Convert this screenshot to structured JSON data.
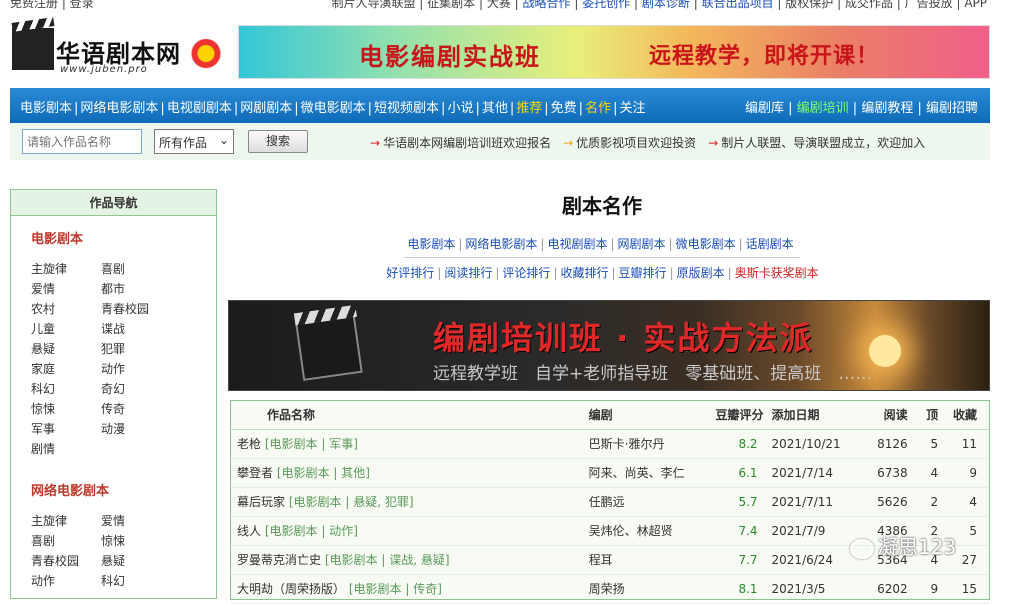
{
  "topbar": {
    "left": "免费注册 | 登录",
    "right_items": [
      "制片人导演联盟",
      "征集剧本",
      "大赛",
      "战略合作",
      "委托创作",
      "剧本诊断",
      "联合出品项目",
      "版权保护",
      "成交作品",
      "广告投放",
      "APP"
    ]
  },
  "logo": {
    "title": "华语剧本网",
    "url": "www.juben.pro"
  },
  "banner_top": {
    "text1": "电影编剧实战班",
    "text2": "远程教学，即将开课！"
  },
  "nav": {
    "items": [
      "电影剧本",
      "网络电影剧本",
      "电视剧剧本",
      "网剧剧本",
      "微电影剧本",
      "短视频剧本",
      "小说",
      "其他"
    ],
    "highlight_items": [
      "推荐",
      "免费",
      "名作",
      "关注"
    ],
    "right_items": [
      "编剧库",
      "编剧培训",
      "编剧教程",
      "编剧招聘"
    ]
  },
  "search": {
    "placeholder": "请输入作品名称",
    "select_value": "所有作品",
    "button": "搜索",
    "notices": [
      "华语剧本网编剧培训班欢迎报名",
      "优质影视项目欢迎投资",
      "制片人联盟、导演联盟成立，欢迎加入"
    ]
  },
  "sidebar": {
    "title": "作品导航",
    "sections": [
      {
        "title": "电影剧本",
        "items": [
          "主旋律",
          "喜剧",
          "爱情",
          "都市",
          "农村",
          "青春校园",
          "儿童",
          "谍战",
          "悬疑",
          "犯罪",
          "家庭",
          "动作",
          "科幻",
          "奇幻",
          "惊悚",
          "传奇",
          "军事",
          "动漫",
          "剧情"
        ]
      },
      {
        "title": "网络电影剧本",
        "items": [
          "主旋律",
          "爱情",
          "喜剧",
          "惊悚",
          "青春校园",
          "悬疑",
          "动作",
          "科幻"
        ]
      }
    ]
  },
  "main": {
    "title": "剧本名作",
    "links1": [
      "电影剧本",
      "网络电影剧本",
      "电视剧剧本",
      "网剧剧本",
      "微电影剧本",
      "话剧剧本"
    ],
    "links2": [
      "好评排行",
      "阅读排行",
      "评论排行",
      "收藏排行",
      "豆瓣排行",
      "原版剧本",
      "奥斯卡获奖剧本"
    ]
  },
  "promo": {
    "title": "编剧培训班 · 实战方法派",
    "subtitle": "远程教学班　自学+老师指导班　零基础班、提高班　……"
  },
  "table": {
    "headers": [
      "作品名称",
      "编剧",
      "豆瓣评分",
      "添加日期",
      "阅读",
      "顶",
      "收藏"
    ],
    "rows": [
      {
        "name": "老枪",
        "tag": "[电影剧本 | 军事]",
        "writer": "巴斯卡·雅尔丹",
        "score": "8.2",
        "date": "2021/10/21",
        "reads": "8126",
        "up": "5",
        "fav": "11"
      },
      {
        "name": "攀登者",
        "tag": "[电影剧本 | 其他]",
        "writer": "阿来、尚英、李仁",
        "score": "6.1",
        "date": "2021/7/14",
        "reads": "6738",
        "up": "4",
        "fav": "9"
      },
      {
        "name": "幕后玩家",
        "tag": "[电影剧本 | 悬疑, 犯罪]",
        "writer": "任鹏远",
        "score": "5.7",
        "date": "2021/7/11",
        "reads": "5626",
        "up": "2",
        "fav": "4"
      },
      {
        "name": "线人",
        "tag": "[电影剧本 | 动作]",
        "writer": "吴炜伦、林超贤",
        "score": "7.4",
        "date": "2021/7/9",
        "reads": "4386",
        "up": "2",
        "fav": "5"
      },
      {
        "name": "罗曼蒂克消亡史",
        "tag": "[电影剧本 | 谍战, 悬疑]",
        "writer": "程耳",
        "score": "7.7",
        "date": "2021/6/24",
        "reads": "5364",
        "up": "4",
        "fav": "27"
      },
      {
        "name": "大明劫（周荣扬版）",
        "tag": "[电影剧本 | 传奇]",
        "writer": "周荣扬",
        "score": "8.1",
        "date": "2021/3/5",
        "reads": "6202",
        "up": "9",
        "fav": "15"
      }
    ]
  },
  "watermark": "凝思123"
}
